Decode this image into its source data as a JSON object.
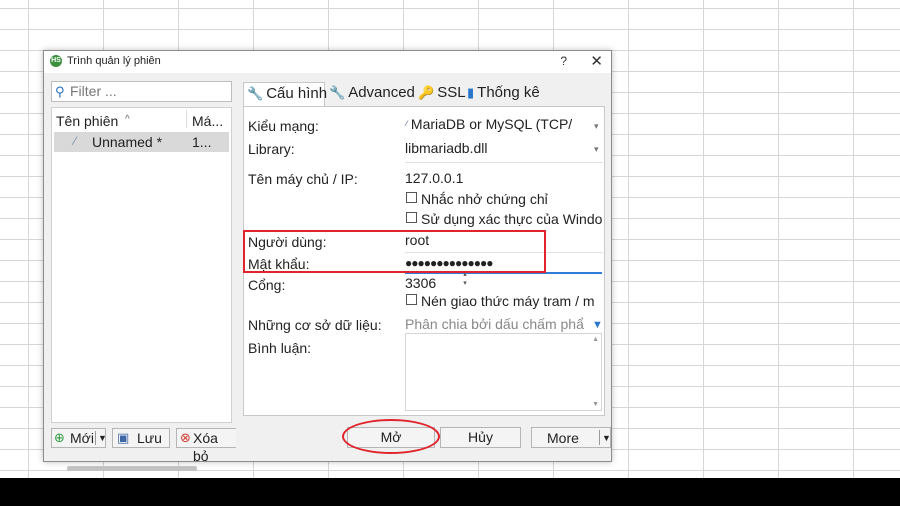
{
  "window": {
    "title": "Trình quản lý phiên",
    "help": "?",
    "close": "✕",
    "app_icon_text": "HS"
  },
  "filter": {
    "icon": "search-icon",
    "placeholder": "Filter ..."
  },
  "session_list": {
    "columns": [
      "Tên phiên",
      "Má..."
    ],
    "sort_glyph": "^",
    "rows": [
      {
        "name": "Unnamed *",
        "value": "1..."
      }
    ]
  },
  "left_buttons": {
    "new": "Mới",
    "save": "Lưu",
    "delete": "Xóa bỏ"
  },
  "tabs": [
    {
      "label": "Cấu hình",
      "icon": "wrench-icon"
    },
    {
      "label": "Advanced",
      "icon": "wrench-icon"
    },
    {
      "label": "SSL",
      "icon": "key-icon"
    },
    {
      "label": "Thống kê",
      "icon": "bar-chart-icon"
    }
  ],
  "settings": {
    "network_type_label": "Kiểu mạng:",
    "network_type_value": "MariaDB or MySQL (TCP/",
    "library_label": "Library:",
    "library_value": "libmariadb.dll",
    "host_label": "Tên máy chủ / IP:",
    "host_value": "127.0.0.1",
    "remember_cert": "Nhắc nhở chứng chỉ",
    "windows_auth": "Sử dụng xác thực của Windo",
    "user_label": "Người dùng:",
    "user_value": "root",
    "password_label": "Mật khẩu:",
    "password_value": "●●●●●●●●●●●●●●",
    "port_label": "Cổng:",
    "port_value": "3306",
    "compression": "Nén giao thức máy tram / m",
    "databases_label": "Những cơ sở dữ liệu:",
    "databases_placeholder": "Phân chia bởi dấu chấm phẩ",
    "comment_label": "Bình luận:"
  },
  "bottom_buttons": {
    "open": "Mở",
    "cancel": "Hủy",
    "more": "More"
  },
  "colors": {
    "annotation": "#e0242c",
    "focus": "#2f7ed8"
  }
}
